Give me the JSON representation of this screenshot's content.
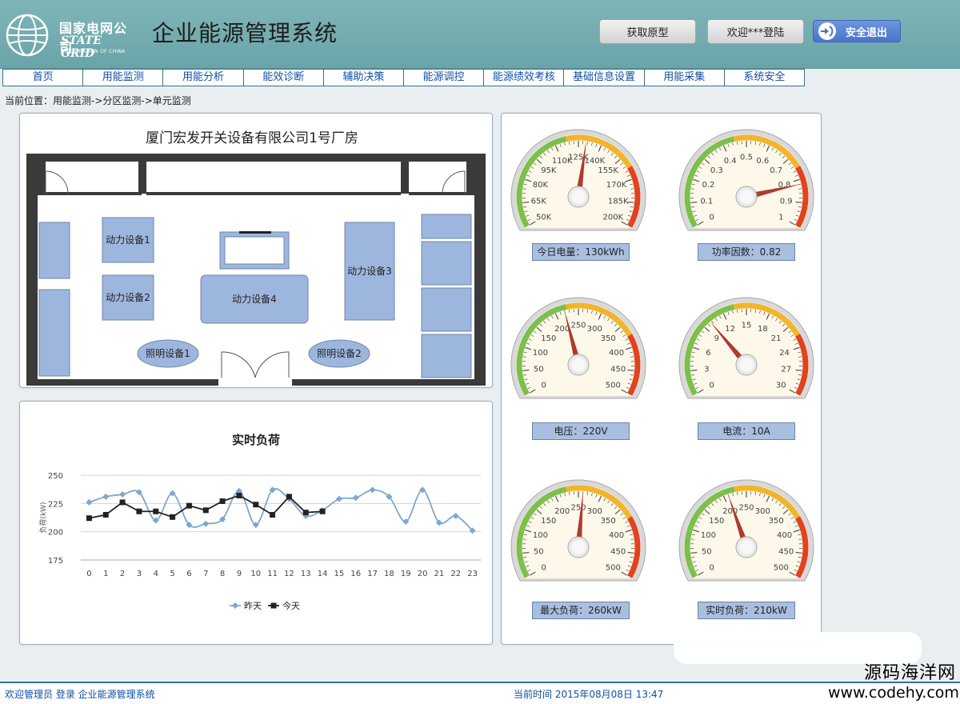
{
  "header": {
    "logo": {
      "cn": "国家电网公司",
      "en": "STATE GRID",
      "sub": "CORPORATION OF CHINA"
    },
    "app_title": "企业能源管理系统",
    "buttons": {
      "prototype": "获取原型",
      "welcome": "欢迎***登陆",
      "logout": "安全退出"
    }
  },
  "nav": {
    "items": [
      "首页",
      "用能监测",
      "用能分析",
      "能效诊断",
      "辅助决策",
      "能源调控",
      "能源绩效考核",
      "基础信息设置",
      "用能采集",
      "系统安全"
    ]
  },
  "breadcrumb": "当前位置：用能监测->分区监测->单元监测",
  "floorplan": {
    "title": "厦门宏发开关设备有限公司1号厂房",
    "equipment": [
      "动力设备1",
      "动力设备2",
      "动力设备3",
      "动力设备4",
      "照明设备1",
      "照明设备2"
    ]
  },
  "chart_data": {
    "type": "line",
    "title": "实时负荷",
    "ylabel": "负荷(kW)",
    "xlabel": "",
    "ylim": [
      175,
      250
    ],
    "yticks": [
      175,
      200,
      225,
      250
    ],
    "x": [
      0,
      1,
      2,
      3,
      4,
      5,
      6,
      7,
      8,
      9,
      10,
      11,
      12,
      13,
      14,
      15,
      16,
      17,
      18,
      19,
      20,
      21,
      22,
      23
    ],
    "series": [
      {
        "name": "昨天",
        "color": "#7ea7cf",
        "marker": "diamond",
        "values": [
          226,
          231,
          233,
          235,
          210,
          234,
          206,
          207,
          211,
          236,
          206,
          237,
          229,
          214,
          219,
          229,
          230,
          237,
          231,
          209,
          237,
          208,
          214,
          201
        ]
      },
      {
        "name": "今天",
        "color": "#222222",
        "marker": "square",
        "values": [
          212,
          215,
          226,
          218,
          218,
          213,
          223,
          219,
          227,
          232,
          224,
          215,
          231,
          217,
          218
        ]
      }
    ],
    "legend_position": "bottom"
  },
  "gauges": [
    {
      "id": "energy",
      "label": "今日电量：130kWh",
      "ticks": [
        "50K",
        "65K",
        "80K",
        "95K",
        "110K",
        "125K",
        "140K",
        "155K",
        "170K",
        "185K",
        "200K"
      ],
      "min": 50,
      "max": 200,
      "value": 130
    },
    {
      "id": "pf",
      "label": "功率因数：0.82",
      "ticks": [
        "0",
        "0.1",
        "0.2",
        "0.3",
        "0.4",
        "0.5",
        "0.6",
        "0.7",
        "0.8",
        "0.9",
        "1"
      ],
      "min": 0,
      "max": 1,
      "value": 0.82
    },
    {
      "id": "voltage",
      "label": "电压：220V",
      "ticks": [
        "0",
        "50",
        "100",
        "150",
        "200",
        "250",
        "300",
        "350",
        "400",
        "450",
        "500"
      ],
      "min": 0,
      "max": 500,
      "value": 220
    },
    {
      "id": "current",
      "label": "电流：10A",
      "ticks": [
        "0",
        "3",
        "6",
        "9",
        "12",
        "15",
        "18",
        "21",
        "24",
        "27",
        "30"
      ],
      "min": 0,
      "max": 30,
      "value": 10
    },
    {
      "id": "maxload",
      "label": "最大负荷：260kW",
      "ticks": [
        "0",
        "50",
        "100",
        "150",
        "200",
        "250",
        "300",
        "350",
        "400",
        "450",
        "500"
      ],
      "min": 0,
      "max": 500,
      "value": 260
    },
    {
      "id": "rtload",
      "label": "实时负荷：210kW",
      "ticks": [
        "0",
        "50",
        "100",
        "150",
        "200",
        "250",
        "300",
        "350",
        "400",
        "450",
        "500"
      ],
      "min": 0,
      "max": 500,
      "value": 210
    }
  ],
  "footer": {
    "left": "欢迎管理员 登录 企业能源管理系统",
    "time": "当前时间 2015年08月08日 13:47"
  },
  "watermark": {
    "cn": "源码海洋网",
    "url": "www.codehy.com"
  },
  "colors": {
    "header": "#7fb5b8",
    "nav_text": "#0e4fa6",
    "label_bg": "#a9bfe0",
    "equipment": "#9db6dd"
  }
}
